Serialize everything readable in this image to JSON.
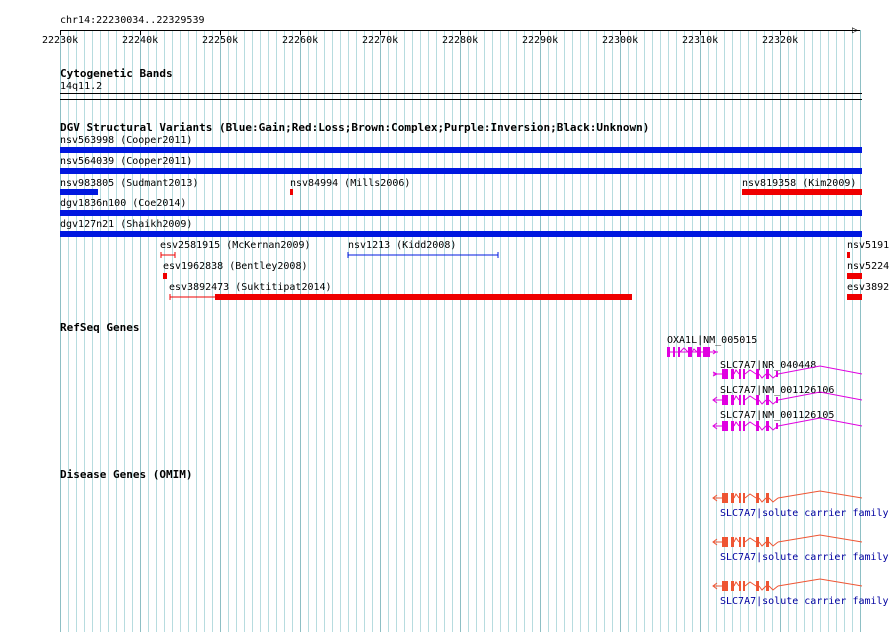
{
  "browser": {
    "region": "chr14:22230034..22329539",
    "ruler_ticks": [
      "22230k",
      "22240k",
      "22250k",
      "22260k",
      "22270k",
      "22280k",
      "22290k",
      "22300k",
      "22310k",
      "22320k"
    ]
  },
  "tracks": {
    "cytoband": {
      "title": "Cytogenetic Bands",
      "band": "14q11.2"
    },
    "dgv": {
      "title": "DGV Structural Variants (Blue:Gain;Red:Loss;Brown:Complex;Purple:Inversion;Black:Unknown)",
      "variants": [
        {
          "label": "nsv563998 (Cooper2011)",
          "type": "gain"
        },
        {
          "label": "nsv564039 (Cooper2011)",
          "type": "gain"
        },
        {
          "label": "nsv983805 (Sudmant2013)",
          "type": "gain"
        },
        {
          "label": "nsv84994 (Mills2006)",
          "type": "loss"
        },
        {
          "label": "nsv819358 (Kim2009)",
          "type": "loss"
        },
        {
          "label": "dgv1836n100 (Coe2014)",
          "type": "gain"
        },
        {
          "label": "dgv127n21 (Shaikh2009)",
          "type": "gain"
        },
        {
          "label": "esv2581915 (McKernan2009)",
          "type": "loss"
        },
        {
          "label": "nsv1213 (Kidd2008)",
          "type": "gain"
        },
        {
          "label": "nsv5191",
          "type": "loss"
        },
        {
          "label": "esv1962838 (Bentley2008)",
          "type": "loss"
        },
        {
          "label": "nsv5224",
          "type": "loss"
        },
        {
          "label": "esv3892473 (Suktitipat2014)",
          "type": "loss"
        },
        {
          "label": "esv3892",
          "type": "loss"
        }
      ]
    },
    "refseq": {
      "title": "RefSeq Genes",
      "genes": [
        {
          "label": "OXA1L|NM_005015"
        },
        {
          "label": "SLC7A7|NR_040448"
        },
        {
          "label": "SLC7A7|NM_001126106"
        },
        {
          "label": "SLC7A7|NM_001126105"
        }
      ]
    },
    "omim": {
      "title": "Disease Genes (OMIM)",
      "genes": [
        {
          "label": "SLC7A7|solute carrier family"
        },
        {
          "label": "SLC7A7|solute carrier family"
        },
        {
          "label": "SLC7A7|solute carrier family"
        }
      ]
    }
  },
  "colors": {
    "gain": "#0018e0",
    "loss": "#ef0000",
    "refseq": "#e000e0",
    "omim": "#ee5533",
    "grid_major": "#8dbfc4",
    "grid_minor": "#b7dcdf"
  },
  "icons": [
    "ruler-arrow-icon"
  ]
}
